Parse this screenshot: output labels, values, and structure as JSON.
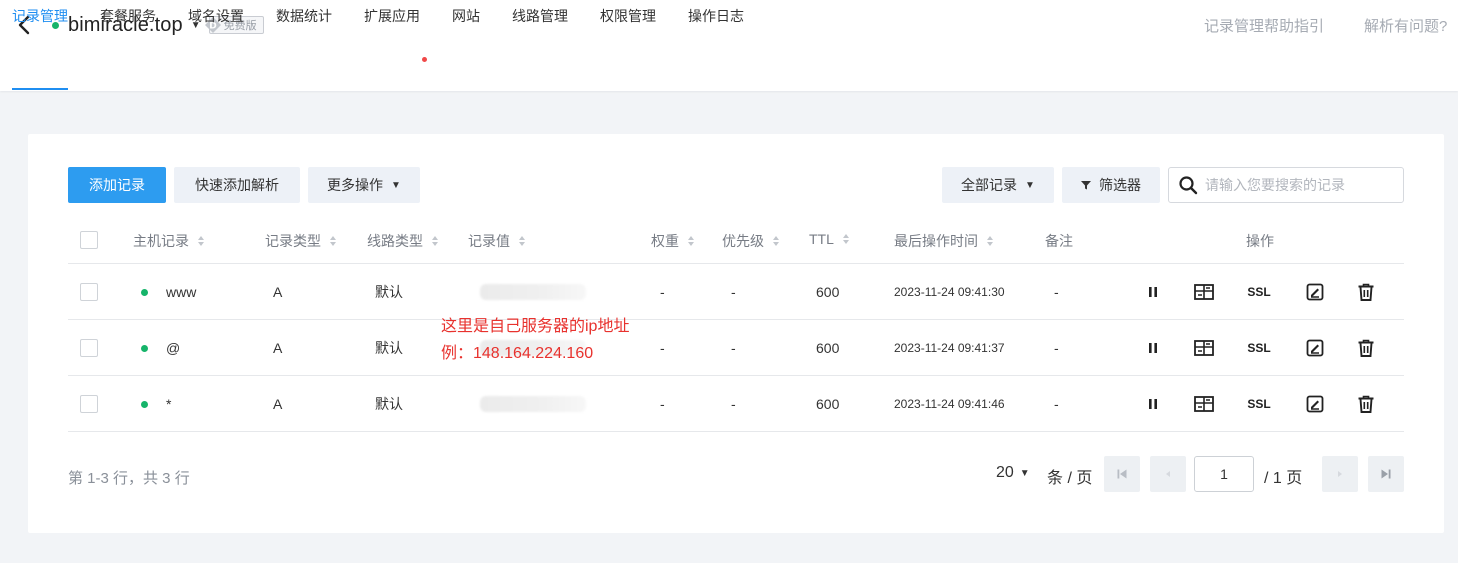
{
  "header": {
    "domain": "bimiracle.top",
    "plan_badge": "免费版",
    "help_links": [
      "记录管理帮助指引",
      "解析有问题?"
    ]
  },
  "tabs": [
    {
      "label": "记录管理",
      "active": true
    },
    {
      "label": "套餐服务"
    },
    {
      "label": "域名设置"
    },
    {
      "label": "数据统计"
    },
    {
      "label": "扩展应用",
      "has_dot": true
    },
    {
      "label": "网站"
    },
    {
      "label": "线路管理"
    },
    {
      "label": "权限管理"
    },
    {
      "label": "操作日志"
    }
  ],
  "toolbar": {
    "add_record": "添加记录",
    "quick_add": "快速添加解析",
    "more_ops": "更多操作",
    "all_records": "全部记录",
    "filter": "筛选器",
    "search_placeholder": "请输入您要搜索的记录"
  },
  "table": {
    "headers": [
      "主机记录",
      "记录类型",
      "线路类型",
      "记录值",
      "权重",
      "优先级",
      "TTL",
      "最后操作时间",
      "备注",
      "操作"
    ],
    "rows": [
      {
        "host": "www",
        "type": "A",
        "line": "默认",
        "weight": "-",
        "priority": "-",
        "ttl": "600",
        "time": "2023-11-24 09:41:30",
        "remark": "-"
      },
      {
        "host": "@",
        "type": "A",
        "line": "默认",
        "weight": "-",
        "priority": "-",
        "ttl": "600",
        "time": "2023-11-24 09:41:37",
        "remark": "-"
      },
      {
        "host": "*",
        "type": "A",
        "line": "默认",
        "weight": "-",
        "priority": "-",
        "ttl": "600",
        "time": "2023-11-24 09:41:46",
        "remark": "-"
      }
    ],
    "ssl_label": "SSL"
  },
  "annotation": {
    "line1": "这里是自己服务器的ip地址",
    "line2": "例：148.164.224.160"
  },
  "pagination": {
    "summary": "第 1-3 行，共 3 行",
    "page_size": "20",
    "per_page_label": "条 / 页",
    "current_page": "1",
    "total_pages": "/ 1 页"
  },
  "colors": {
    "accent": "#1f8ef1",
    "primary_button": "#2d9cf0",
    "status_green": "#16b46a",
    "annotation_red": "#e8322e"
  }
}
